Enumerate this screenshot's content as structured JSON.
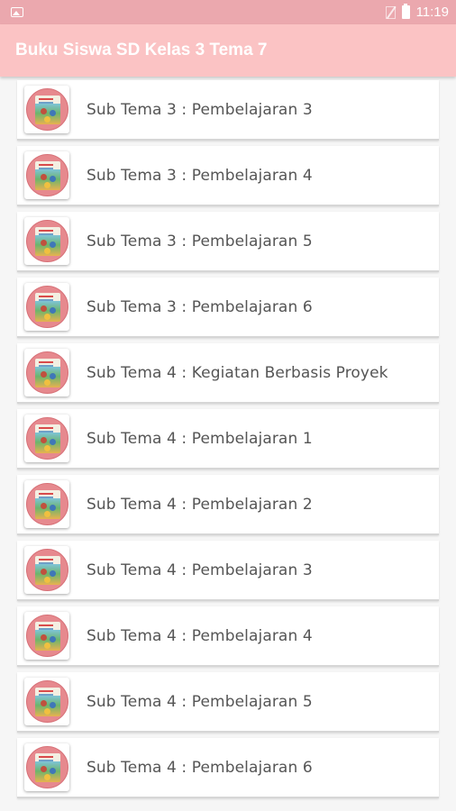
{
  "status_bar": {
    "time": "11:19",
    "icons": [
      "image-notification-icon",
      "no-sim-icon",
      "battery-icon"
    ]
  },
  "app_bar": {
    "title": "Buku Siswa SD Kelas 3 Tema 7"
  },
  "colors": {
    "status_bar": "#eba8ae",
    "app_bar": "#fbc3c4",
    "background": "#f6f6f6"
  },
  "list": {
    "items": [
      {
        "label": "Sub Tema 3 : Pembelajaran 3",
        "icon": "book-cover-thumbnail"
      },
      {
        "label": "Sub Tema 3 : Pembelajaran 4",
        "icon": "book-cover-thumbnail"
      },
      {
        "label": "Sub Tema 3 : Pembelajaran 5",
        "icon": "book-cover-thumbnail"
      },
      {
        "label": "Sub Tema 3 : Pembelajaran 6",
        "icon": "book-cover-thumbnail"
      },
      {
        "label": "Sub Tema 4 : Kegiatan Berbasis Proyek",
        "icon": "book-cover-thumbnail"
      },
      {
        "label": "Sub Tema 4 : Pembelajaran 1",
        "icon": "book-cover-thumbnail"
      },
      {
        "label": "Sub Tema 4 : Pembelajaran 2",
        "icon": "book-cover-thumbnail"
      },
      {
        "label": "Sub Tema 4 : Pembelajaran 3",
        "icon": "book-cover-thumbnail"
      },
      {
        "label": "Sub Tema 4 : Pembelajaran 4",
        "icon": "book-cover-thumbnail"
      },
      {
        "label": "Sub Tema 4 : Pembelajaran 5",
        "icon": "book-cover-thumbnail"
      },
      {
        "label": "Sub Tema 4 : Pembelajaran 6",
        "icon": "book-cover-thumbnail"
      }
    ]
  }
}
